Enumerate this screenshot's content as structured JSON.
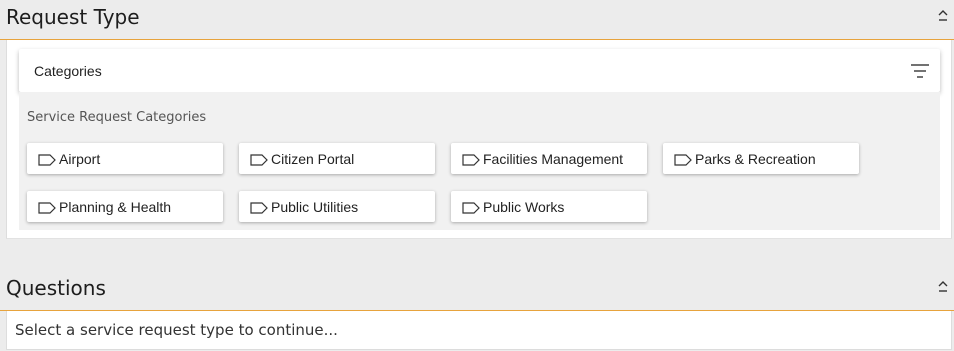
{
  "request_type": {
    "title": "Request Type",
    "collapse_icon": "chevron-up-icon",
    "categories_bar": {
      "label": "Categories",
      "filter_icon": "filter-icon"
    },
    "heading": "Service Request Categories",
    "tag_icon": "tag-icon",
    "categories": [
      "Airport",
      "Citizen Portal",
      "Facilities Management",
      "Parks & Recreation",
      "Planning & Health",
      "Public Utilities",
      "Public Works"
    ]
  },
  "questions": {
    "title": "Questions",
    "collapse_icon": "chevron-up-icon",
    "message": "Select a service request type to continue..."
  },
  "colors": {
    "accent": "#e7a33d",
    "background": "#ececec"
  }
}
